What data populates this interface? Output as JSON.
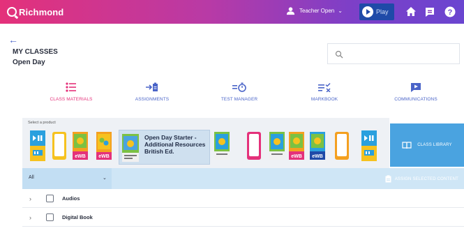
{
  "topbar": {
    "logo": "Richmond",
    "user_label": "Teacher Open",
    "play_label": "Play",
    "icons": [
      "user-icon",
      "play-icon",
      "home-icon",
      "messages-icon",
      "help-icon"
    ]
  },
  "header": {
    "title": "MY CLASSES",
    "subtitle": "Open Day"
  },
  "search": {
    "placeholder": "",
    "value": ""
  },
  "tools": [
    {
      "label": "CLASS MATERIALS",
      "icon": "class-materials-icon",
      "active": true
    },
    {
      "label": "ASSIGNMENTS",
      "icon": "assignments-icon",
      "active": false
    },
    {
      "label": "TEST MANAGER",
      "icon": "test-manager-icon",
      "active": false
    },
    {
      "label": "MARKBOOK",
      "icon": "markbook-icon",
      "active": false
    },
    {
      "label": "COMMUNICATIONS",
      "icon": "communications-icon",
      "active": false
    }
  ],
  "products": {
    "label": "Select a product",
    "selected": {
      "title": "Open Day Starter - Additional Resources British Ed."
    },
    "thumbs": [
      {
        "kind": "media",
        "name": "product-thumb-media-1"
      },
      {
        "kind": "yellow-frame",
        "name": "product-thumb-yellow-frame-1"
      },
      {
        "kind": "ewb-orange",
        "name": "product-thumb-ewb-1"
      },
      {
        "kind": "cover",
        "name": "product-thumb-cover-1"
      },
      {
        "kind": "pink-frame",
        "name": "product-thumb-pink-frame"
      },
      {
        "kind": "cover",
        "name": "product-thumb-cover-2"
      },
      {
        "kind": "ewb-orange",
        "name": "product-thumb-ewb-2"
      },
      {
        "kind": "ewb-blue",
        "name": "product-thumb-ewb-3"
      },
      {
        "kind": "orange-frame",
        "name": "product-thumb-orange-frame"
      },
      {
        "kind": "media",
        "name": "product-thumb-media-2"
      }
    ],
    "thumb_labels": {
      "ewb": "eWB"
    },
    "class_library_label": "CLASS LIBRARY"
  },
  "filter": {
    "value": "All",
    "assign_label": "ASSIGN SELECTED CONTENT"
  },
  "rows": [
    {
      "label": "Audios"
    },
    {
      "label": "Digital Book"
    }
  ],
  "colors": {
    "accent_pink": "#e4317a",
    "accent_blue": "#4a64c8",
    "library_blue": "#4aa3e0",
    "filter_bg": "#cfe6f6"
  }
}
